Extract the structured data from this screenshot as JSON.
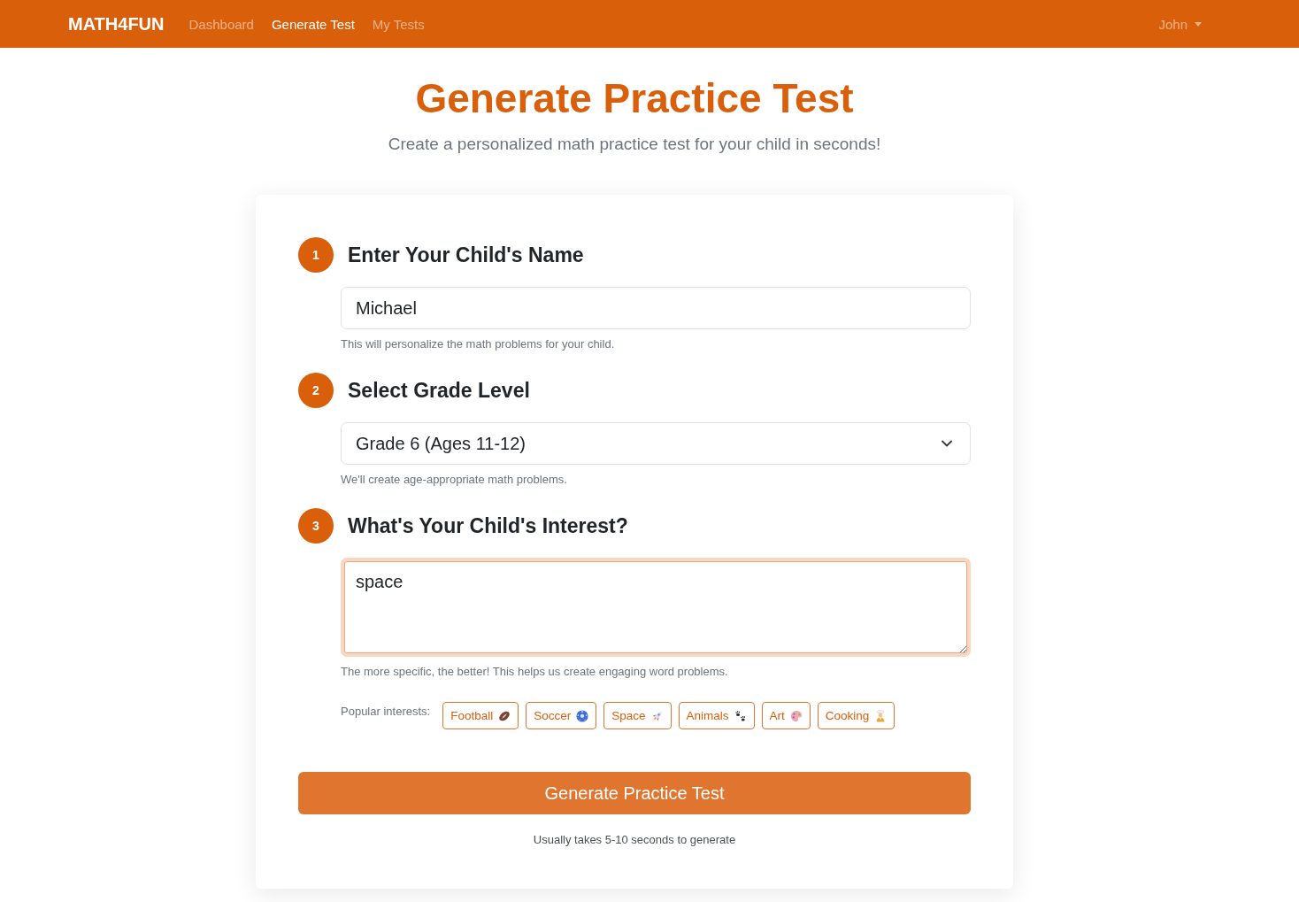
{
  "navbar": {
    "brand": "MATH4FUN",
    "links": [
      {
        "label": "Dashboard",
        "selected": false
      },
      {
        "label": "Generate Test",
        "selected": true
      },
      {
        "label": "My Tests",
        "selected": false
      }
    ],
    "user_menu": {
      "label": "John"
    }
  },
  "header": {
    "title": "Generate Practice Test",
    "subtitle": "Create a personalized math practice test for your child in seconds!"
  },
  "steps": [
    {
      "number": "1",
      "title": "Enter Your Child's Name",
      "field": {
        "kind": "text",
        "value": "Michael",
        "focused": false
      },
      "help": "This will personalize the math problems for your child."
    },
    {
      "number": "2",
      "title": "Select Grade Level",
      "field": {
        "kind": "select",
        "value": "Grade 6 (Ages 11-12)",
        "focused": false
      },
      "help": "We'll create age-appropriate math problems."
    },
    {
      "number": "3",
      "title": "What's Your Child's Interest?",
      "field": {
        "kind": "textarea",
        "value": "space",
        "focused": true
      },
      "help": "The more specific, the better! This helps us create engaging word problems.",
      "suggestions": {
        "label": "Popular interests:",
        "chips": [
          {
            "label": "Football",
            "kind": "football"
          },
          {
            "label": "Soccer",
            "kind": "soccer"
          },
          {
            "label": "Space",
            "kind": "rocket"
          },
          {
            "label": "Animals",
            "kind": "paws"
          },
          {
            "label": "Art",
            "kind": "palette"
          },
          {
            "label": "Cooking",
            "kind": "cook"
          }
        ]
      }
    }
  ],
  "submit": {
    "label": "Generate Practice Test",
    "note": "Usually takes 5-10 seconds to generate"
  }
}
